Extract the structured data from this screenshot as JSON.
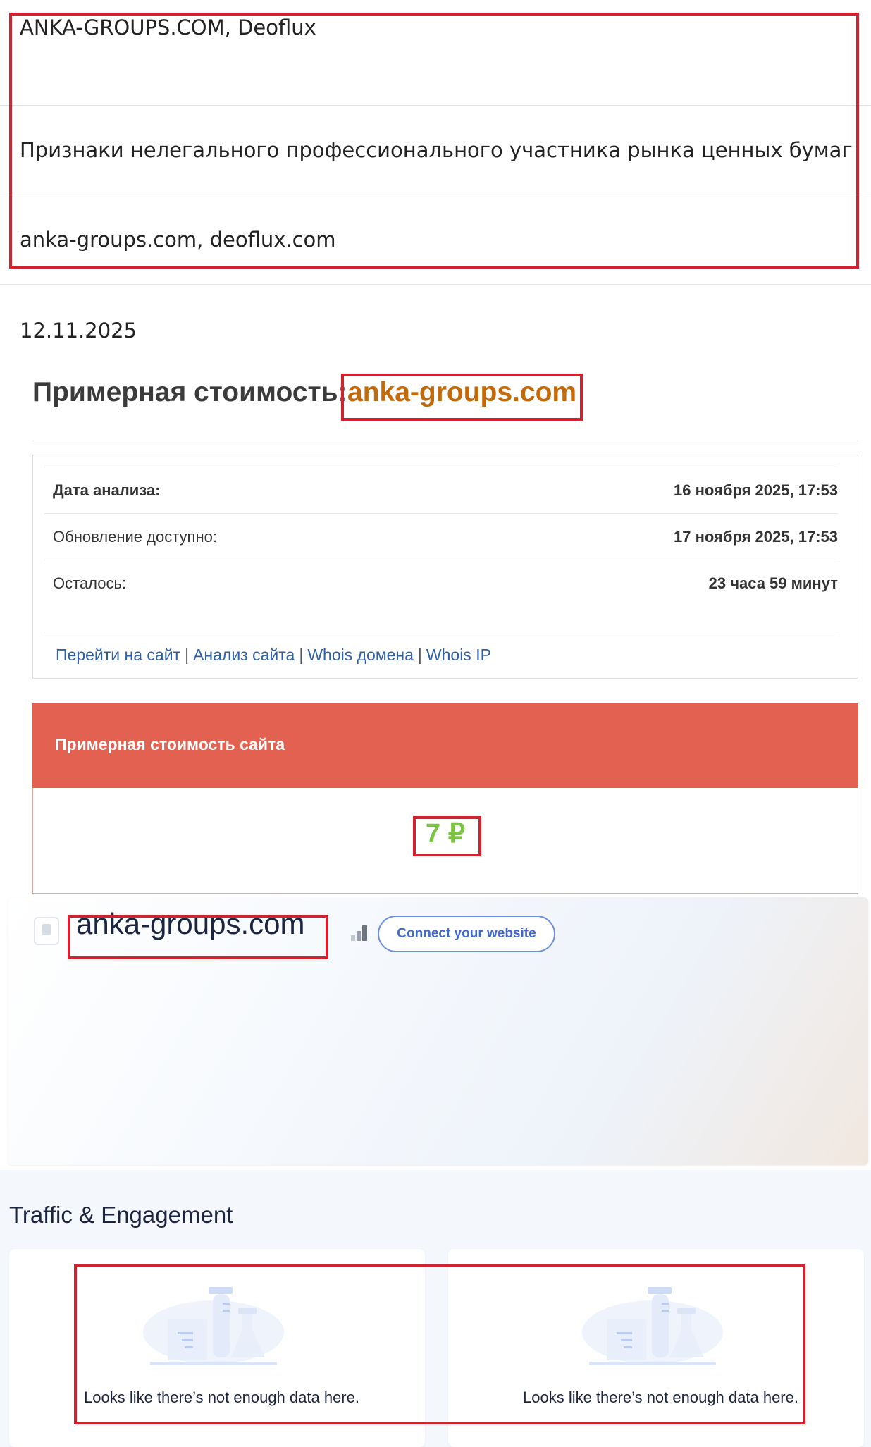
{
  "registry": {
    "names": "ANKA-GROUPS.COM, Deoflux",
    "reason": "Признаки нелегального профессионального участника рынка ценных бумаг",
    "sites": "anka-groups.com, deoflux.com",
    "date": "12.11.2025"
  },
  "estimate": {
    "title": "Примерная стоимость:",
    "domain": "anka-groups.com",
    "rows": [
      {
        "label": "Дата анализа:",
        "value": "16 ноября 2025, 17:53"
      },
      {
        "label": "Обновление доступно:",
        "value": "17 ноября 2025, 17:53"
      },
      {
        "label": "Осталось:",
        "value": "23 часа 59 минут"
      }
    ],
    "links": [
      "Перейти на сайт",
      "Анализ сайта",
      "Whois домена",
      "Whois IP"
    ],
    "cost_header": "Примерная стоимость сайта",
    "cost_value": "7 ₽"
  },
  "site_card": {
    "domain": "anka-groups.com",
    "connect_label": "Connect your website"
  },
  "traffic": {
    "title": "Traffic & Engagement",
    "empty_messages": [
      "Looks like there’s not enough data here.",
      "Looks like there’s not enough data here."
    ]
  },
  "colors": {
    "highlight_box": "#d3222f",
    "domain_orange": "#c26a0b",
    "cost_header_bg": "#e26150",
    "price_green": "#7cc244",
    "link_blue": "#2f5fa6"
  }
}
